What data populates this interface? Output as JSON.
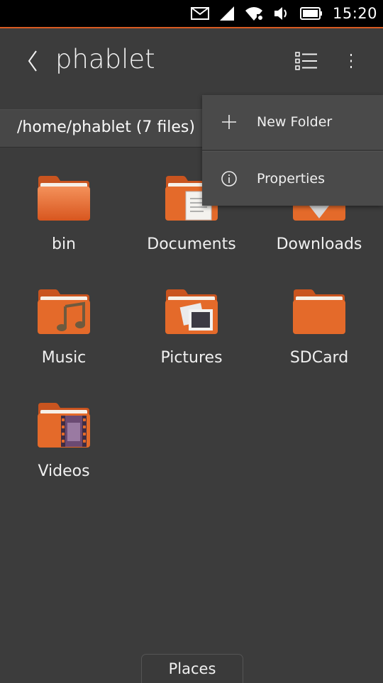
{
  "status_bar": {
    "time": "15:20",
    "icons": [
      "mail-icon",
      "signal-icon",
      "wifi-icon",
      "volume-icon",
      "battery-icon"
    ]
  },
  "header": {
    "title": "phablet",
    "back_icon": "chevron-left-icon",
    "view_icon": "list-view-icon",
    "overflow_icon": "overflow-icon"
  },
  "path_bar": {
    "text": "/home/phablet (7 files)"
  },
  "items": [
    {
      "label": "bin",
      "icon": "folder-icon"
    },
    {
      "label": "Documents",
      "icon": "folder-documents-icon"
    },
    {
      "label": "Downloads",
      "icon": "folder-downloads-icon"
    },
    {
      "label": "Music",
      "icon": "folder-music-icon"
    },
    {
      "label": "Pictures",
      "icon": "folder-pictures-icon"
    },
    {
      "label": "SDCard",
      "icon": "folder-icon"
    },
    {
      "label": "Videos",
      "icon": "folder-videos-icon"
    }
  ],
  "popup_menu": {
    "items": [
      {
        "label": "New Folder",
        "icon": "plus-icon"
      },
      {
        "label": "Properties",
        "icon": "info-icon"
      }
    ]
  },
  "bottom_tab": {
    "label": "Places"
  },
  "colors": {
    "background": "#3c3c3c",
    "accent": "#d95b22",
    "folder_orange": "#e46a2a",
    "text": "#f0f0f0"
  }
}
